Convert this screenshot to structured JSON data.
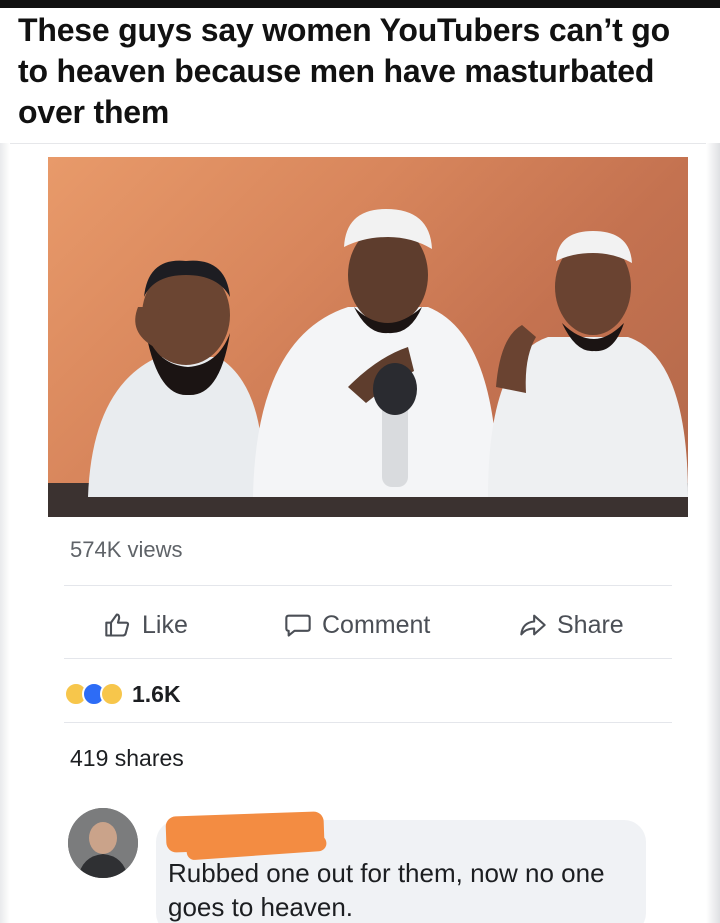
{
  "caption": "These guys say women YouTubers can’t go to heaven because men have masturbated over them",
  "post": {
    "views": "574K views",
    "actions": {
      "like": "Like",
      "comment": "Comment",
      "share": "Share"
    },
    "reactions": {
      "icons": [
        "haha-icon",
        "love-icon",
        "sad-icon"
      ],
      "count": "1.6K"
    },
    "shares": "419 shares"
  },
  "comment": {
    "text": "Rubbed one out for them, now no one goes to heaven."
  },
  "colors": {
    "redaction": "#f38c42",
    "reaction_haha": "#f7c64b",
    "reaction_love": "#2d6cf6",
    "comment_bg": "#f0f2f5"
  }
}
